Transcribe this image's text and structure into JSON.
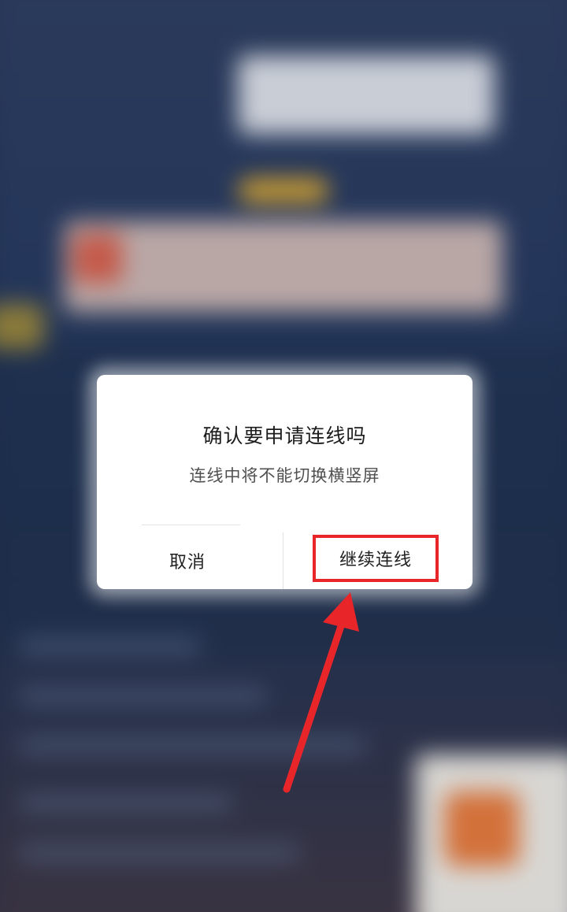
{
  "dialog": {
    "title": "确认要申请连线吗",
    "message": "连线中将不能切换横竖屏",
    "cancel_label": "取消",
    "confirm_label": "继续连线"
  },
  "annotation": {
    "highlight_color": "#e8262a",
    "arrow_color": "#e8262a"
  }
}
